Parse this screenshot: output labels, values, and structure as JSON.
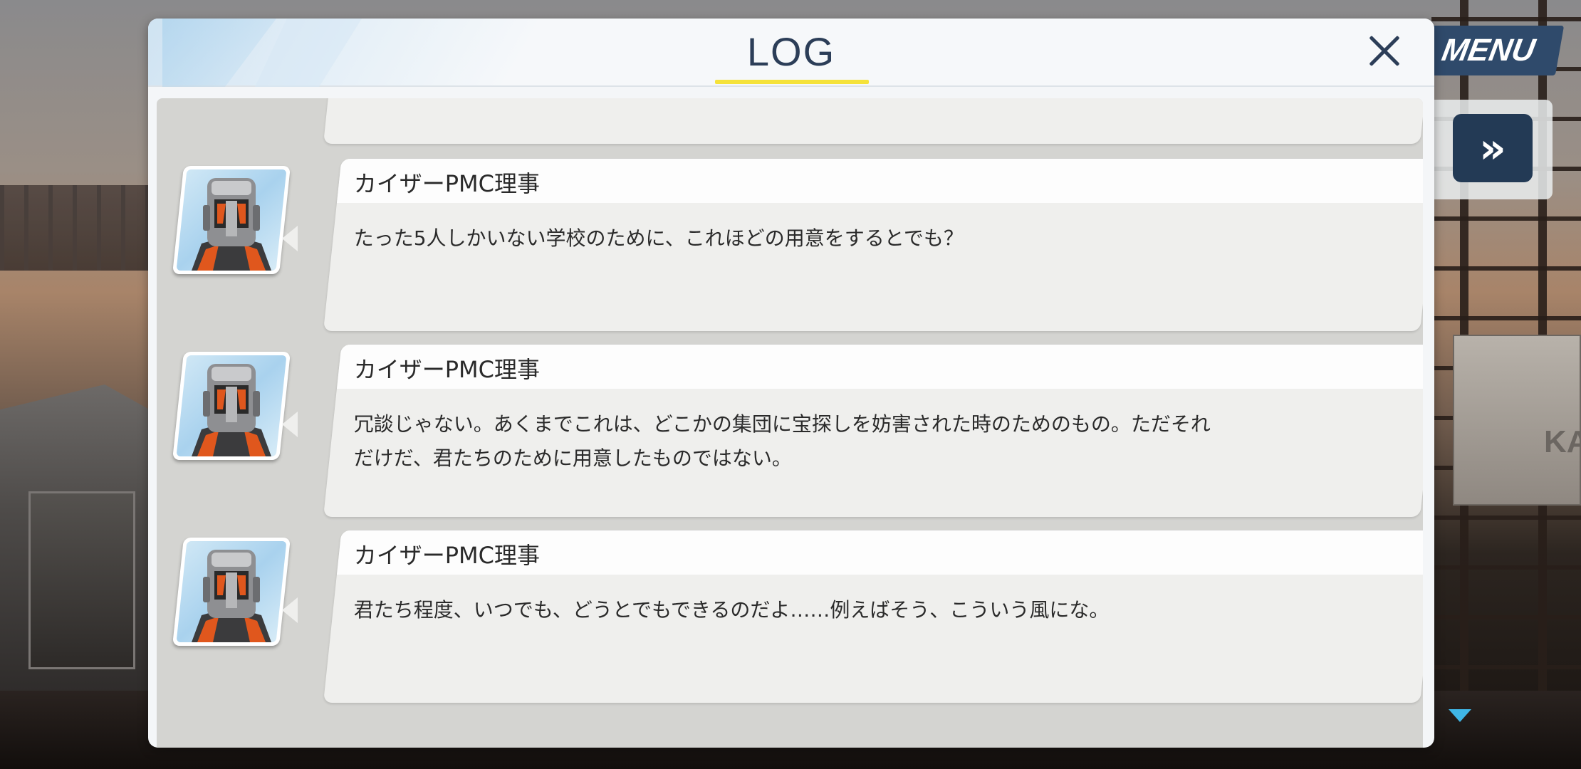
{
  "hud": {
    "menu_label": "MENU",
    "fast_forward_glyph": "»",
    "wall_sign": "KA"
  },
  "log": {
    "title": "LOG",
    "close_glyph": "×",
    "entries": [
      {
        "speaker": "",
        "text": ""
      },
      {
        "speaker": "カイザーPMC理事",
        "text": "たった5人しかいない学校のために、これほどの用意をするとでも？"
      },
      {
        "speaker": "カイザーPMC理事",
        "text": "冗談じゃない。あくまでこれは、どこかの集団に宝探しを妨害された時のためのもの。ただそれだけだ、君たちのために用意したものではない。"
      },
      {
        "speaker": "カイザーPMC理事",
        "text": "君たち程度、いつでも、どうとでもできるのだよ……例えばそう、こういう風にな。"
      }
    ]
  },
  "colors": {
    "title_text": "#2c3e58",
    "title_underline": "#f5e23a",
    "menu_button": "#2f4a6b",
    "scroll_indicator": "#3fb6e6"
  },
  "icons": {
    "close": "close-icon",
    "fast_forward": "fast-forward-icon",
    "scroll_down": "scroll-down-arrow-icon",
    "portrait": "kaiser-pmc-director-portrait"
  }
}
